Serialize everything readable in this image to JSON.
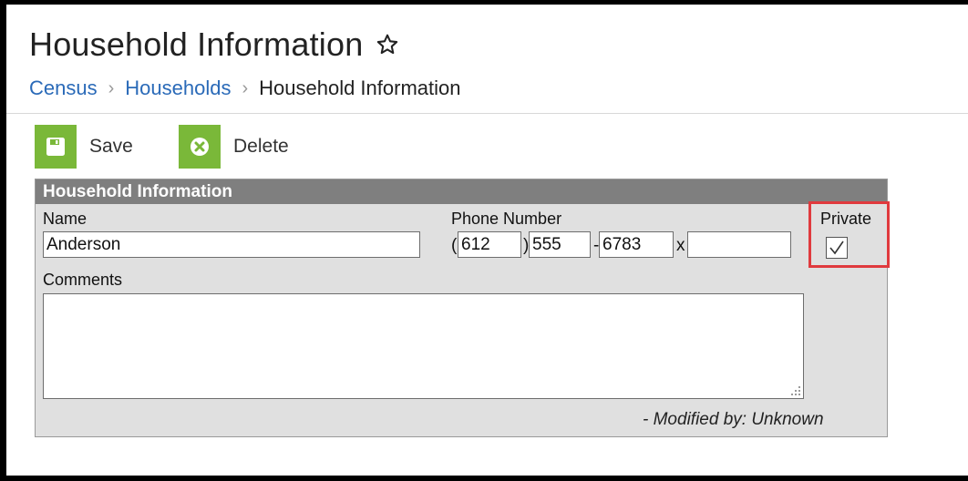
{
  "header": {
    "title": "Household Information",
    "breadcrumb": [
      "Census",
      "Households",
      "Household Information"
    ]
  },
  "toolbar": {
    "save_label": "Save",
    "delete_label": "Delete"
  },
  "panel": {
    "title": "Household Information",
    "name_label": "Name",
    "name_value": "Anderson",
    "phone_label": "Phone Number",
    "phone_area": "612",
    "phone_prefix": "555",
    "phone_line": "6783",
    "phone_ext": "",
    "phone_open_paren": "(",
    "phone_close_paren": ")",
    "phone_dash": "-",
    "phone_ext_sep": "x",
    "private_label": "Private",
    "private_checked": true,
    "comments_label": "Comments",
    "comments_value": "",
    "modified_text": "- Modified by: Unknown"
  },
  "colors": {
    "accent_green": "#7ab839",
    "link_blue": "#2a6ab8",
    "highlight_red": "#e03a3e",
    "panel_header": "#7f7f7f"
  },
  "icons": {
    "favorite": "star-outline-icon",
    "save": "floppy-disk-icon",
    "delete": "x-circle-icon",
    "separator": "chevron-right-icon"
  }
}
